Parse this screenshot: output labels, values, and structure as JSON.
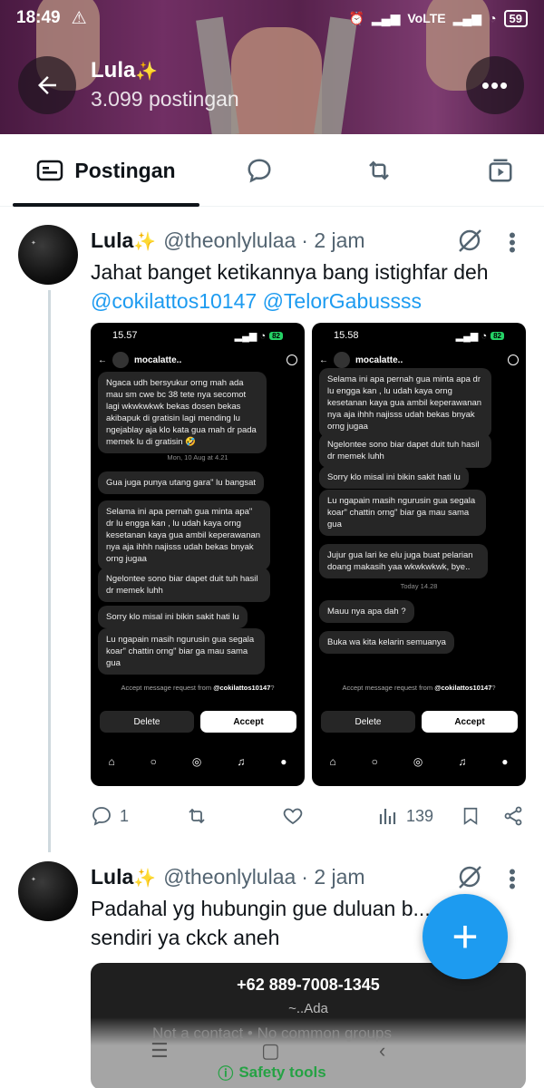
{
  "status_bar": {
    "time": "18:49",
    "battery": "59",
    "network": "VoLTE"
  },
  "header": {
    "name": "Lula",
    "post_count": "3.099 postingan",
    "back_icon": "arrow-left-icon",
    "more_icon": "ellipsis-icon"
  },
  "tabs": {
    "active_label": "Postingan",
    "items": [
      "posts-icon",
      "replies-icon",
      "reposts-icon",
      "media-icon"
    ]
  },
  "posts": [
    {
      "name": "Lula",
      "handle": "@theonlylulaa",
      "time": "· 2 jam",
      "text": "Jahat banget ketikannya bang istighfar deh",
      "mentions": [
        "@cokilattos10147",
        "@TelorGabussss"
      ],
      "stats": {
        "replies": "1",
        "views": "139"
      },
      "screenshots": [
        {
          "time": "15.57",
          "battery": "82",
          "chat_name": "mocalatte..",
          "messages": [
            "Ngaca udh bersyukur orng mah ada mau sm cwe bc 38 tete nya secomot lagi wkwkwkwk bekas dosen bekas akibapuk di gratisin lagi mending lu ngejablay aja klo kata gua mah dr pada memek lu di gratisin 🤣",
            "Gua juga punya utang gara\" lu bangsat",
            "Selama ini apa pernah gua minta apa\" dr lu engga kan , lu udah kaya orng kesetanan kaya gua ambil keperawanan nya aja ihhh najisss udah bekas bnyak orng jugaa",
            "Ngelontee sono biar dapet duit tuh hasil dr memek luhh",
            "Sorry klo misal ini bikin sakit hati lu",
            "Lu ngapain masih ngurusin gua segala koar\" chattin orng\" biar ga mau sama gua"
          ],
          "day_separator": "Mon, 10 Aug at 4.21",
          "accept_note": "Accept message request from",
          "accept_user": "@cokilattos10147",
          "delete_label": "Delete",
          "accept_label": "Accept"
        },
        {
          "time": "15.58",
          "battery": "82",
          "chat_name": "mocalatte..",
          "messages": [
            "Selama ini apa pernah gua minta apa dr lu engga kan , lu udah kaya orng kesetanan kaya gua ambil keperawanan nya aja ihhh najisss udah bekas bnyak orng jugaa",
            "Ngelontee sono biar dapet duit tuh hasil dr memek luhh",
            "Sorry klo misal ini bikin sakit hati lu",
            "Lu ngapain masih ngurusin gua segala koar\" chattin orng\" biar ga mau sama gua",
            "Jujur gua lari ke elu juga buat pelarian doang makasih yaa wkwkwkwk, bye..",
            "Mauu nya apa dah ?",
            "Buka wa kita kelarin semuanya"
          ],
          "day_separator": "Today 14.28",
          "accept_note": "Accept message request from",
          "accept_user": "@cokilattos10147",
          "delete_label": "Delete",
          "accept_label": "Accept"
        }
      ]
    },
    {
      "name": "Lula",
      "handle": "@theonlylulaa",
      "time": "· 2 jam",
      "text": "Padahal yg hubungin gue duluan b... sendiri ya ckck aneh",
      "image": {
        "phone": "+62 889-7008-1345",
        "about": "~..Ada"
      }
    }
  ],
  "overlay": {
    "not_contact": "Not a contact • No common groups",
    "safety_tools": "Safety tools"
  },
  "colors": {
    "accent": "#1d9bf0",
    "text": "#0f1419",
    "muted": "#536471",
    "safety_green": "#25a244"
  }
}
